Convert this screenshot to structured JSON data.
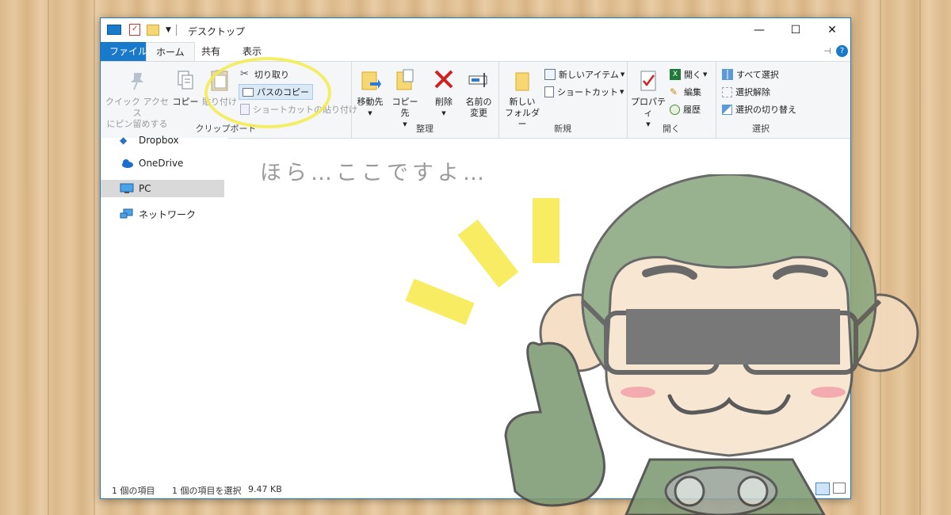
{
  "window": {
    "title": "デスクトップ",
    "controls": {
      "minimize": "—",
      "maximize": "☐",
      "close": "✕"
    }
  },
  "tabs": [
    {
      "label": "ファイル"
    },
    {
      "label": "ホーム"
    },
    {
      "label": "共有"
    },
    {
      "label": "表示"
    }
  ],
  "ribbon": {
    "clipboard": {
      "label": "クリップボード",
      "pin": "クイック アクセス\nにピン留めする",
      "copy": "コピー",
      "paste": "貼り付け",
      "cut": "切り取り",
      "copy_path": "パスのコピー",
      "paste_shortcut": "ショートカットの貼り付け"
    },
    "organize": {
      "label": "整理",
      "move_to": "移動先",
      "copy_to": "コピー先",
      "delete": "削除",
      "rename": "名前の\n変更"
    },
    "new": {
      "label": "新規",
      "new_folder": "新しい\nフォルダー",
      "new_item": "新しいアイテム",
      "shortcut": "ショートカット"
    },
    "open": {
      "label": "開く",
      "properties": "プロパティ",
      "open": "開く",
      "edit": "編集",
      "history": "履歴"
    },
    "select": {
      "label": "選択",
      "select_all": "すべて選択",
      "select_none": "選択解除",
      "invert": "選択の切り替え"
    }
  },
  "sidebar": {
    "items": [
      {
        "label": "Dropbox"
      },
      {
        "label": "OneDrive"
      },
      {
        "label": "PC"
      },
      {
        "label": "ネットワーク"
      }
    ]
  },
  "status": {
    "count": "1 個の項目",
    "selected": "1 個の項目を選択",
    "size": "9.47 KB"
  },
  "overlay": {
    "caption": "ほら…ここですよ…"
  },
  "colors": {
    "accent": "#1979ca",
    "highlight_ring": "#f2ec4c",
    "rays": "#f7ea52",
    "character_green": "#8aa880"
  }
}
